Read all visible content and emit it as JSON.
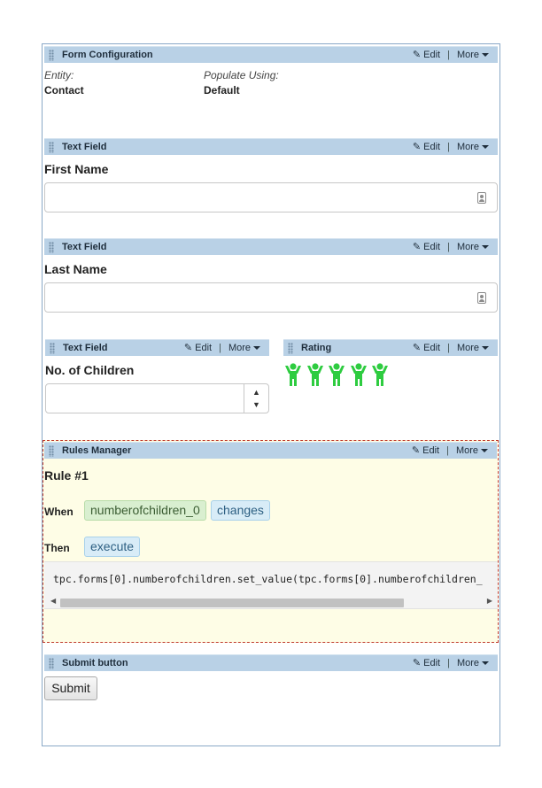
{
  "bar_actions": {
    "edit": "Edit",
    "more": "More"
  },
  "form_config": {
    "title": "Form Configuration",
    "entity_label": "Entity:",
    "entity_value": "Contact",
    "populate_label": "Populate Using:",
    "populate_value": "Default"
  },
  "first_name": {
    "title": "Text Field",
    "label": "First Name",
    "value": ""
  },
  "last_name": {
    "title": "Text Field",
    "label": "Last Name",
    "value": ""
  },
  "children": {
    "title": "Text Field",
    "label": "No. of Children",
    "value": ""
  },
  "rating": {
    "title": "Rating",
    "value": 5,
    "max": 5,
    "color": "#2ecc40"
  },
  "rules": {
    "title": "Rules Manager",
    "rule_name": "Rule #1",
    "when_label": "When",
    "when_field": "numberofchildren_0",
    "when_event": "changes",
    "then_label": "Then",
    "then_action": "execute",
    "code": "tpc.forms[0].numberofchildren.set_value(tpc.forms[0].numberofchildren_"
  },
  "submit": {
    "title": "Submit button",
    "label": "Submit"
  },
  "colors": {
    "bar_bg": "#b9d1e6",
    "rules_bg": "#fefde6",
    "rules_border": "#c0392b"
  }
}
